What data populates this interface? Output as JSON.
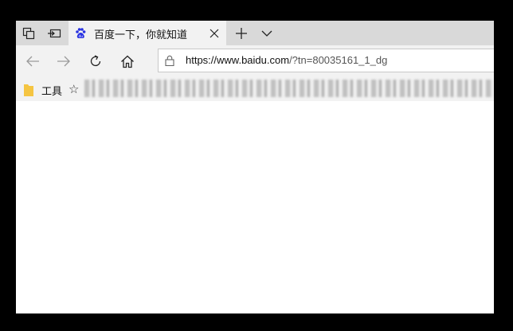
{
  "tab": {
    "title": "百度一下，你就知道"
  },
  "address_bar": {
    "url_domain": "https://www.baidu.com",
    "url_rest": "/?tn=80035161_1_dg"
  },
  "favorites_bar": {
    "folder_label": "工具",
    "star_glyph": "☆"
  },
  "icons": {
    "set_aside": "tab-sets-icon",
    "back": "back-arrow-icon",
    "forward": "forward-arrow-icon",
    "refresh": "refresh-icon",
    "home": "home-icon",
    "lock": "lock-icon",
    "baidu": "baidu-paw-icon"
  },
  "colors": {
    "titlebar": "#d9d9d9",
    "toolbar": "#f2f2f2",
    "baidu_blue": "#2932e1",
    "folder": "#f5c542"
  }
}
